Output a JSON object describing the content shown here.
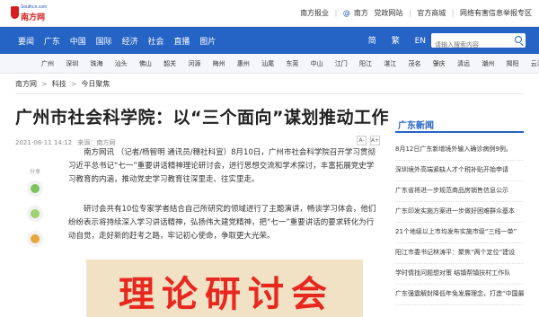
{
  "site": {
    "logo_url_text": "Southcn.com",
    "logo_name": "南方网"
  },
  "top_links": {
    "item1": "南方报业",
    "item2": "南方",
    "item3": "党政网站",
    "item4": "官方商城",
    "item5": "网络有害信息举报专区"
  },
  "nav": {
    "items": [
      "要闻",
      "广东",
      "中国",
      "国际",
      "经济",
      "社会",
      "直播",
      "图片"
    ],
    "lang": [
      "简",
      "繁",
      "EN"
    ],
    "search_placeholder": "请输入搜索内容"
  },
  "cities": [
    "广州",
    "深圳",
    "珠海",
    "汕头",
    "佛山",
    "韶关",
    "河源",
    "梅州",
    "惠州",
    "汕尾",
    "东莞",
    "中山",
    "江门",
    "阳江",
    "湛江",
    "茂名",
    "肇庆",
    "清远",
    "潮州",
    "揭阳",
    "云浮"
  ],
  "breadcrumb": [
    "南方网",
    "科技",
    "今日聚焦"
  ],
  "article": {
    "title": "广州市社会科学院：以“三个面向”谋划推动工作",
    "date": "2021-08-11 14:12",
    "source": "来源：南方网",
    "font_minus": "A-",
    "font_plus": "A+",
    "share_label": "分享",
    "paragraph1": "南方网讯 （记者/杨智明 通讯员/穗社科宣）8月10日，广州市社会科学院召开学习贯彻习近平总书记“七一”重要讲话精神理论研讨会，进行思想交流和学术探讨，丰富拓展党史学习教育的内涵，推动党史学习教育往深里走、往实里走。",
    "paragraph2": "研讨会共有10位专家学者结合自己所研究的领域进行了主题演讲，畅谈学习体会，他们纷纷表示将持续深入学习讲话精神，弘扬伟大建党精神，把“七一”重要讲话的要求转化为行动自觉，走好新的赶考之路，牢记初心使命，争取更大光荣。",
    "banner_text": "理论研讨会"
  },
  "sidebar": {
    "title": "广东新闻",
    "items": [
      "8月12日广东新增境外输入确诊病例9例。",
      "深圳境外高端紧缺人才个税补贴开始申请",
      "广东省将进一步规范商品房销售信息公示",
      "广东印发实施方案进一步做好困难群众基本",
      "21个地级以上市均发布实施市级“三线一单”",
      "阳江市委书记林涛平：聚焦“两个定位”建设",
      "学时情找问题想对策 结镇帮镇扶村工作队",
      "广东强震解封降低年免发展理念，打造“中国最美"
    ]
  },
  "colors": {
    "brand_blue": "#2563c4",
    "brand_red": "#d71e1e",
    "banner_bg": "#f1e2c5",
    "banner_text": "#e8281f"
  },
  "icons": {
    "logo": "southcn-logo",
    "search": "search-icon",
    "share1": "wechat-icon",
    "share2": "moments-icon",
    "share3": "weibo-icon"
  }
}
